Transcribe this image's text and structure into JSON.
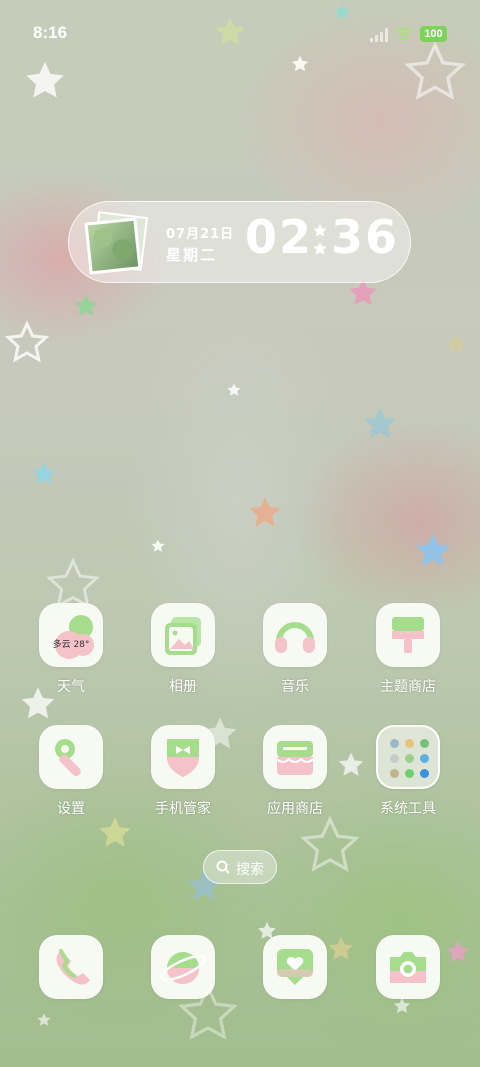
{
  "status_bar": {
    "time": "8:16",
    "battery": "100"
  },
  "widget": {
    "date": "07月21日",
    "weekday": "星期二",
    "hour": "02",
    "minute": "36"
  },
  "apps_row1": [
    {
      "label": "天气",
      "icon": "weather-icon",
      "weather_text": "多云 28°"
    },
    {
      "label": "相册",
      "icon": "gallery-icon"
    },
    {
      "label": "音乐",
      "icon": "music-icon"
    },
    {
      "label": "主题商店",
      "icon": "theme-store-icon"
    }
  ],
  "apps_row2": [
    {
      "label": "设置",
      "icon": "settings-icon"
    },
    {
      "label": "手机管家",
      "icon": "phone-manager-icon"
    },
    {
      "label": "应用商店",
      "icon": "app-store-icon"
    },
    {
      "label": "系统工具",
      "icon": "system-tools-folder-icon"
    }
  ],
  "search": {
    "label": "搜索"
  },
  "dock": [
    {
      "icon": "phone-icon"
    },
    {
      "icon": "browser-icon"
    },
    {
      "icon": "messages-icon"
    },
    {
      "icon": "camera-icon"
    }
  ],
  "colors": {
    "accent_green": "#8fd17a",
    "accent_pink": "#f0b3c0",
    "battery": "#7dd35a"
  }
}
